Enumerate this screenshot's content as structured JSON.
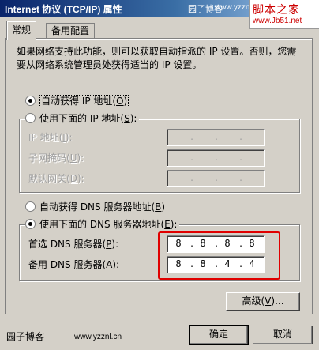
{
  "window": {
    "title": "Internet 协议 (TCP/IP) 属性",
    "watermark": "园子博客",
    "watermark_url": "www.yzznl.cn"
  },
  "logo": {
    "line1": "脚本之家",
    "line2": "www.Jb51.net"
  },
  "tabs": [
    {
      "label": "常规",
      "active": true
    },
    {
      "label": "备用配置",
      "active": false
    }
  ],
  "description": "如果网络支持此功能，则可以获取自动指派的 IP 设置。否则，您需要从网络系统管理员处获得适当的 IP 设置。",
  "ip_section": {
    "auto_option": {
      "label": "自动获得 IP 地址",
      "key": "O",
      "selected": true
    },
    "manual_option": {
      "label": "使用下面的 IP 地址",
      "key": "S",
      "selected": false
    },
    "fields": [
      {
        "label": "IP 地址",
        "key": "I",
        "octets": [
          "",
          "",
          "",
          ""
        ]
      },
      {
        "label": "子网掩码",
        "key": "U",
        "octets": [
          "",
          "",
          "",
          ""
        ]
      },
      {
        "label": "默认网关",
        "key": "D",
        "octets": [
          "",
          "",
          "",
          ""
        ]
      }
    ]
  },
  "dns_section": {
    "auto_option": {
      "label": "自动获得 DNS 服务器地址",
      "key": "B",
      "selected": false
    },
    "manual_option": {
      "label": "使用下面的 DNS 服务器地址",
      "key": "E",
      "selected": true
    },
    "fields": [
      {
        "label": "首选 DNS 服务器",
        "key": "P",
        "octets": [
          "8",
          "8",
          "8",
          "8"
        ]
      },
      {
        "label": "备用 DNS 服务器",
        "key": "A",
        "octets": [
          "8",
          "8",
          "4",
          "4"
        ]
      }
    ]
  },
  "buttons": {
    "advanced": {
      "label": "高级",
      "key": "V"
    },
    "ok": "确定",
    "cancel": "取消"
  },
  "footer": {
    "brand": "园子博客",
    "url": "www.yzznl.cn"
  },
  "colors": {
    "highlight": "#e00000",
    "title_bar": "#0a246a",
    "dialog_bg": "#d4d0c8"
  }
}
